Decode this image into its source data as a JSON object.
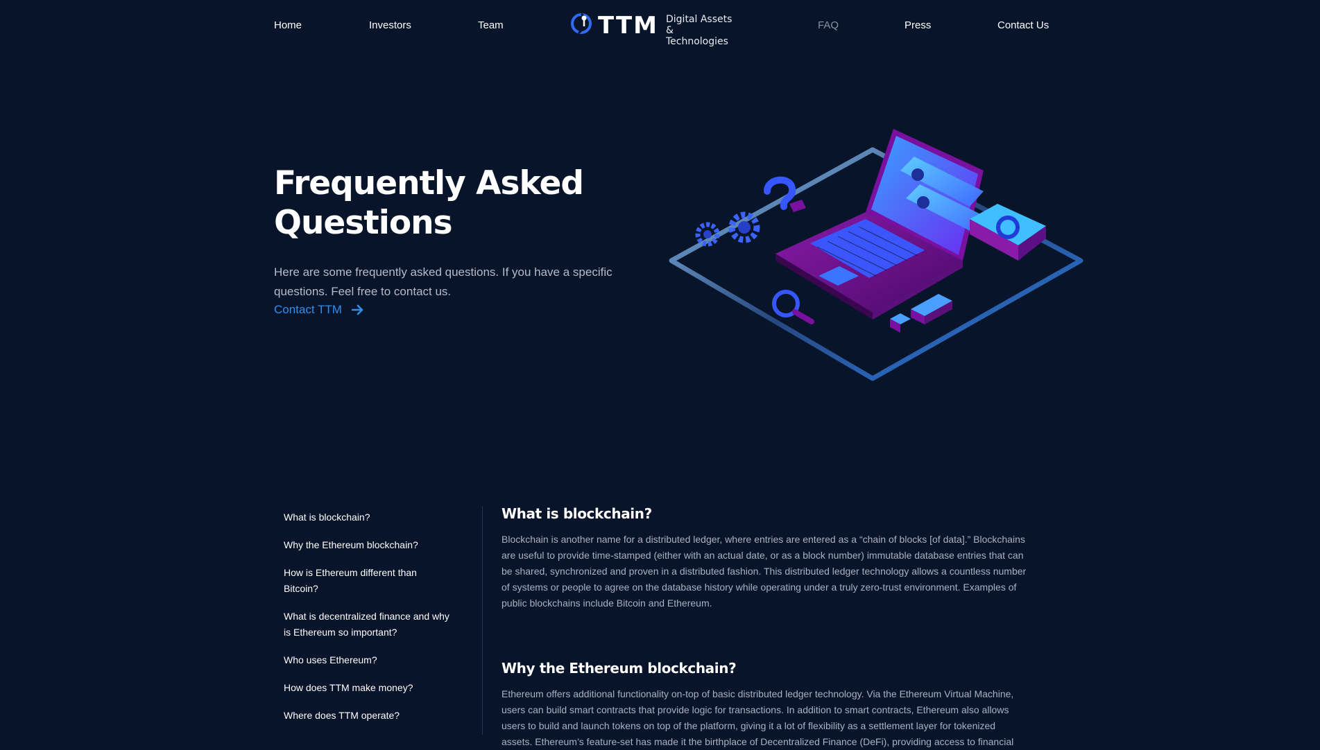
{
  "nav": {
    "items": [
      {
        "label": "Home"
      },
      {
        "label": "Investors"
      },
      {
        "label": "Team"
      },
      {
        "label": "FAQ"
      },
      {
        "label": "Press"
      },
      {
        "label": "Contact Us"
      }
    ],
    "active": "FAQ"
  },
  "logo": {
    "wordmark": "TTM",
    "tagline_line1": "Digital Assets",
    "tagline_line2": "& Technologies",
    "icon": "globe-pin-icon"
  },
  "hero": {
    "title_line1": "Frequently Asked",
    "title_line2": "Questions",
    "text": "Here are some frequently asked questions. If you have a specific questions. Feel free to contact us.",
    "link_label": "Contact TTM",
    "link_icon": "arrow-right-icon",
    "illustration": "isometric-laptop-illustration"
  },
  "faq_nav": [
    "What is blockchain?",
    "Why the Ethereum blockchain?",
    "How is Ethereum different than Bitcoin?",
    "What is decentralized finance and why is Ethereum so important?",
    "Who uses Ethereum?",
    "How does TTM make money?",
    "Where does TTM operate?"
  ],
  "faq": [
    {
      "title": "What is blockchain?",
      "body": "Blockchain is another name for a distributed ledger, where entries are entered as a “chain of blocks [of data].” Blockchains are useful to provide time-stamped (either with an actual date, or as a block number) immutable database entries that can be shared, synchronized and proven in a distributed fashion. This distributed ledger technology allows a countless number of systems or people to agree on the database history while operating under a truly zero-trust environment. Examples of public blockchains include Bitcoin and Ethereum."
    },
    {
      "title": "Why the Ethereum blockchain?",
      "body": "Ethereum offers additional functionality on-top of basic distributed ledger technology. Via the Ethereum Virtual Machine, users can build smart contracts that provide logic for transactions. In addition to smart contracts, Ethereum also allows users to build and launch tokens on top of the platform, giving it a lot of flexibility as a settlement layer for tokenized assets. Ethereum’s feature-set has made it the birthplace of Decentralized Finance (DeFi), providing access to financial"
    }
  ],
  "colors": {
    "background": "#08142a",
    "accent": "#2d8ff0",
    "muted_text": "#a9b2c2",
    "active_nav": "#8a93a3"
  }
}
